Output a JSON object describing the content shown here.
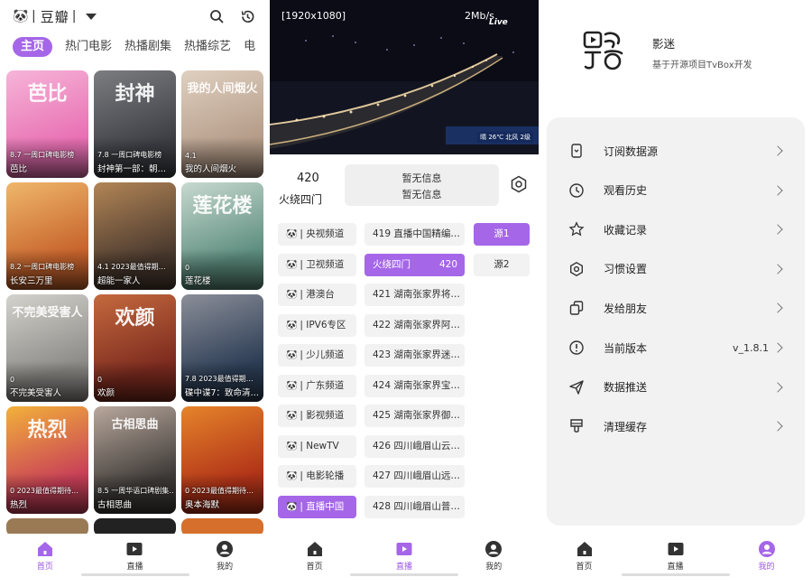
{
  "colors": {
    "accent": "#a566e8",
    "card_bg": "#f2f2f2"
  },
  "home": {
    "brand": "豆瓣",
    "logo_icon": "panda-icon",
    "tabs": [
      {
        "label": "主页",
        "active": true
      },
      {
        "label": "热门电影",
        "active": false
      },
      {
        "label": "热播剧集",
        "active": false
      },
      {
        "label": "热播综艺",
        "active": false
      },
      {
        "label": "电",
        "active": false
      }
    ],
    "cards": [
      {
        "meta": "8.7 一周口碑电影榜",
        "title": "芭比",
        "color": "#e86fb3",
        "color2": "#f6b5d8",
        "poster": "芭比"
      },
      {
        "meta": "7.8 一周口碑电影榜",
        "title": "封神第一部：朝…",
        "color": "#3d3f45",
        "color2": "#7b7d80",
        "poster": "封神"
      },
      {
        "meta": "4.1",
        "title": "我的人间烟火",
        "color": "#b49b88",
        "color2": "#e0d0c0",
        "poster": "我的人间烟火"
      },
      {
        "meta": "8.2 一周口碑电影榜",
        "title": "长安三万里",
        "color": "#c7632c",
        "color2": "#efb76b",
        "poster": ""
      },
      {
        "meta": "4.1 2023最值得期…",
        "title": "超能一家人",
        "color": "#4b3a2f",
        "color2": "#b28556",
        "poster": ""
      },
      {
        "meta": "0",
        "title": "莲花楼",
        "color": "#5d8e7f",
        "color2": "#c8d9d0",
        "poster": "莲花楼"
      },
      {
        "meta": "0",
        "title": "不完美受害人",
        "color": "#8d8b87",
        "color2": "#d4d2cc",
        "poster": "不完美受害人"
      },
      {
        "meta": "0",
        "title": "欢颜",
        "color": "#7d2b1f",
        "color2": "#c56a3e",
        "poster": "欢颜"
      },
      {
        "meta": "7.8 2023最值得期…",
        "title": "碟中谍7：致命清…",
        "color": "#2c3d55",
        "color2": "#8b8e98",
        "poster": ""
      },
      {
        "meta": "0 2023最值得期待…",
        "title": "热烈",
        "color": "#c83f58",
        "color2": "#f2b13a",
        "poster": "热烈"
      },
      {
        "meta": "8.5 一周华语口碑剧集…",
        "title": "古相思曲",
        "color": "#3f3b38",
        "color2": "#b9a89d",
        "poster": "古相思曲"
      },
      {
        "meta": "0 2023最值得期待…",
        "title": "奥本海默",
        "color": "#b13218",
        "color2": "#e5842a",
        "poster": ""
      },
      {
        "meta": "",
        "title": "",
        "color": "#9a7a55",
        "color2": "#9a7a55",
        "poster": ""
      },
      {
        "meta": "",
        "title": "",
        "color": "#222222",
        "color2": "#222222",
        "poster": ""
      },
      {
        "meta": "",
        "title": "",
        "color": "#d66f2c",
        "color2": "#d66f2c",
        "poster": ""
      }
    ],
    "nav": [
      {
        "label": "首页",
        "icon": "home-icon",
        "active": true
      },
      {
        "label": "直播",
        "icon": "play-icon",
        "active": false
      },
      {
        "label": "我的",
        "icon": "user-icon",
        "active": false
      }
    ]
  },
  "live": {
    "resolution": "[1920x1080]",
    "speed": "2Mb/s",
    "watermark": "Live",
    "caption": "晴 26℃ 北风 2级",
    "channel_number": "420",
    "channel_name": "火绕四门",
    "epg_line1": "暂无信息",
    "epg_line2": "暂无信息",
    "groups": [
      {
        "label": "央视频道",
        "selected": false
      },
      {
        "label": "卫视频道",
        "selected": false
      },
      {
        "label": "港澳台",
        "selected": false
      },
      {
        "label": "IPV6专区",
        "selected": false
      },
      {
        "label": "少儿频道",
        "selected": false
      },
      {
        "label": "广东频道",
        "selected": false
      },
      {
        "label": "影视频道",
        "selected": false
      },
      {
        "label": "NewTV",
        "selected": false
      },
      {
        "label": "电影轮播",
        "selected": false
      },
      {
        "label": "直播中国",
        "selected": true
      }
    ],
    "channels": [
      {
        "label": "419 直播中国精编…",
        "selected": false
      },
      {
        "label": "火绕四门",
        "num": "420",
        "selected": true
      },
      {
        "label": "421 湖南张家界将…",
        "selected": false
      },
      {
        "label": "422 湖南张家界阿…",
        "selected": false
      },
      {
        "label": "423 湖南张家界迷…",
        "selected": false
      },
      {
        "label": "424 湖南张家界宝…",
        "selected": false
      },
      {
        "label": "425 湖南张家界御…",
        "selected": false
      },
      {
        "label": "426 四川峨眉山云…",
        "selected": false
      },
      {
        "label": "427 四川峨眉山远…",
        "selected": false
      },
      {
        "label": "428 四川峨眉山普…",
        "selected": false
      }
    ],
    "sources": [
      {
        "label": "源1",
        "selected": true
      },
      {
        "label": "源2",
        "selected": false
      }
    ],
    "nav": [
      {
        "label": "首页",
        "active": false
      },
      {
        "label": "直播",
        "active": true
      },
      {
        "label": "我的",
        "active": false
      }
    ]
  },
  "mine": {
    "app_name": "影迷",
    "app_desc": "基于开源项目TvBox开发",
    "items": [
      {
        "label": "订阅数据源",
        "icon": "subscription-icon",
        "value": ""
      },
      {
        "label": "观看历史",
        "icon": "clock-icon",
        "value": ""
      },
      {
        "label": "收藏记录",
        "icon": "star-icon",
        "value": ""
      },
      {
        "label": "习惯设置",
        "icon": "hexagon-settings-icon",
        "value": ""
      },
      {
        "label": "发给朋友",
        "icon": "share-copy-icon",
        "value": ""
      },
      {
        "label": "当前版本",
        "icon": "info-icon",
        "value": "v_1.8.1"
      },
      {
        "label": "数据推送",
        "icon": "send-icon",
        "value": ""
      },
      {
        "label": "清理缓存",
        "icon": "brush-icon",
        "value": ""
      }
    ],
    "nav": [
      {
        "label": "首页",
        "active": false
      },
      {
        "label": "直播",
        "active": false
      },
      {
        "label": "我的",
        "active": true
      }
    ]
  }
}
